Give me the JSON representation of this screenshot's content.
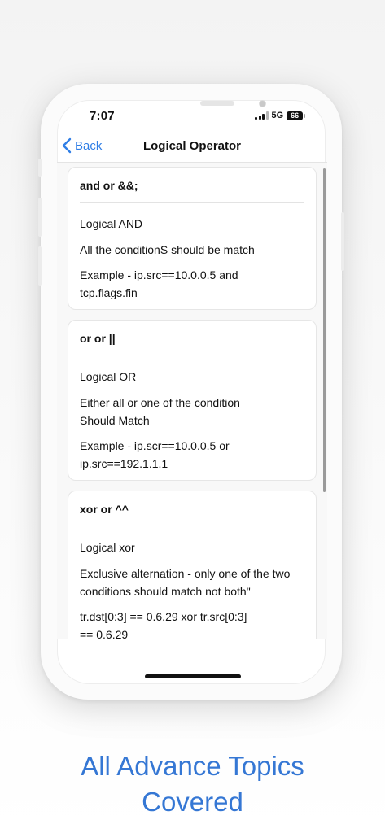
{
  "status_bar": {
    "time": "7:07",
    "network": "5G",
    "battery": "66"
  },
  "navbar": {
    "back_label": "Back",
    "title": "Logical Operator"
  },
  "cards": [
    {
      "title": "and or &&;",
      "subtitle": "Logical AND",
      "description": "All the conditionS should be match",
      "example": "Example - ip.src==10.0.0.5 and\ntcp.flags.fin"
    },
    {
      "title": "or or ||",
      "subtitle": "Logical OR",
      "description": "Either all or one of the condition\nShould Match",
      "example": "Example - ip.scr==10.0.0.5 or\nip.src==192.1.1.1"
    },
    {
      "title": "xor or ^^",
      "subtitle": "Logical xor",
      "description": "Exclusive alternation - only one of the two\nconditions should match not both\"",
      "example": "tr.dst[0:3] == 0.6.29 xor tr.src[0:3]\n== 0.6.29"
    }
  ],
  "caption": {
    "line1": "All Advance Topics",
    "line2": "Covered"
  },
  "colors": {
    "accent": "#2f7ee6",
    "caption": "#3577d4"
  }
}
